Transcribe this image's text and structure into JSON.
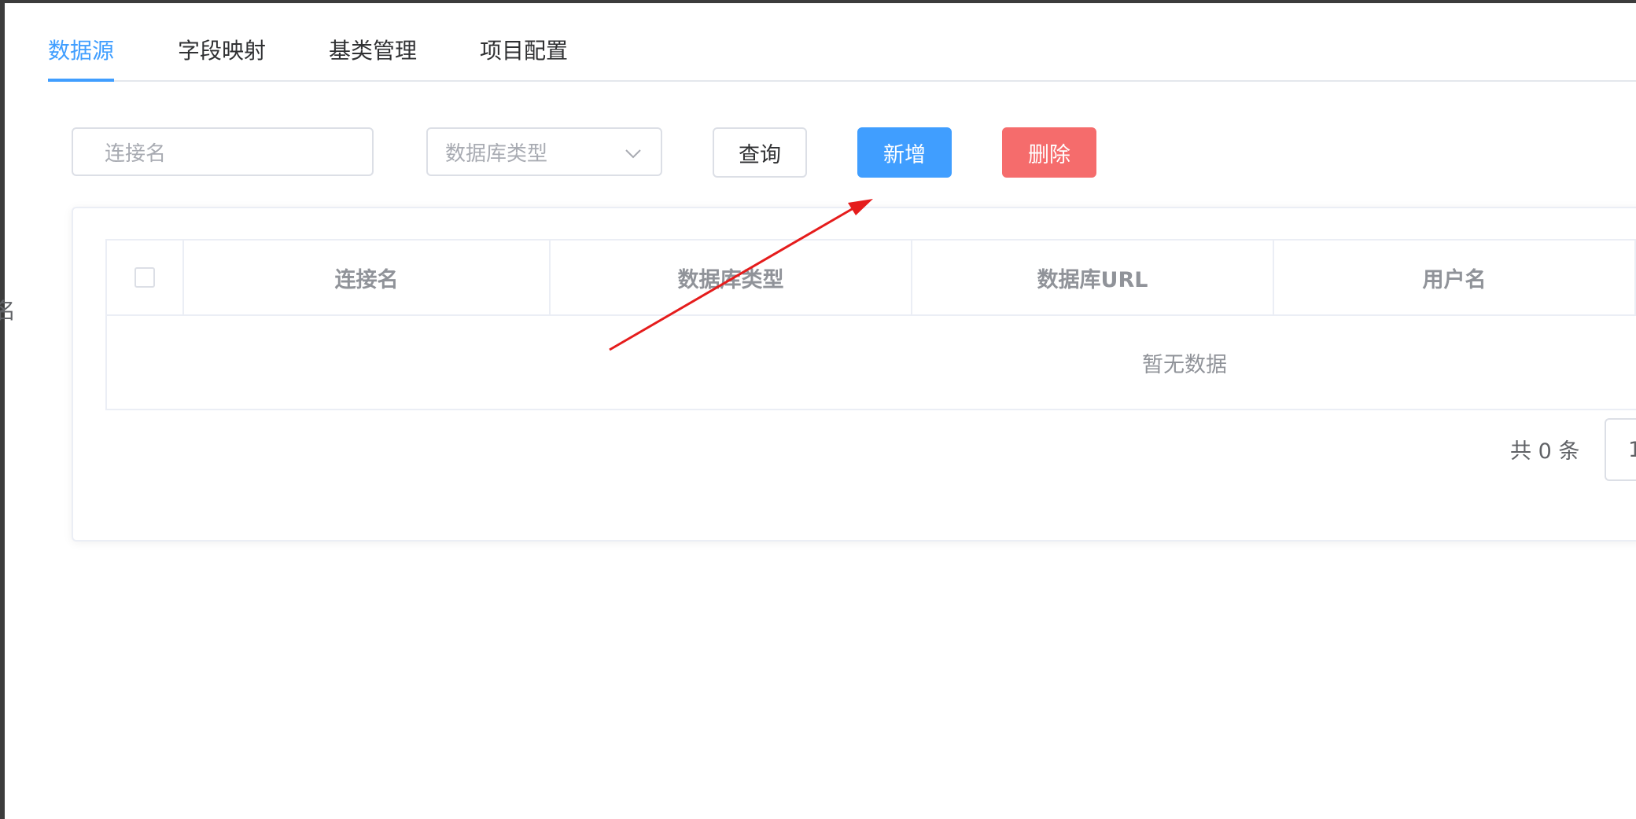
{
  "tabs": [
    {
      "label": "数据源",
      "active": true
    },
    {
      "label": "字段映射",
      "active": false
    },
    {
      "label": "基类管理",
      "active": false
    },
    {
      "label": "项目配置",
      "active": false
    }
  ],
  "left_edge_glyph": "名",
  "filters": {
    "connection_name_placeholder": "连接名",
    "db_type_placeholder": "数据库类型"
  },
  "buttons": {
    "query": "查询",
    "add": "新增",
    "delete": "删除"
  },
  "table": {
    "columns": [
      "连接名",
      "数据库类型",
      "数据库URL",
      "用户名"
    ],
    "empty_text": "暂无数据"
  },
  "pagination": {
    "total_text": "共 0 条",
    "page_size_partial": "1"
  },
  "colors": {
    "primary": "#409eff",
    "danger": "#f56c6c",
    "annotation_arrow": "#e51c1c"
  },
  "icons": {
    "select_chevron": "chevron-down-icon",
    "annotation": "red-arrow-annotation"
  }
}
